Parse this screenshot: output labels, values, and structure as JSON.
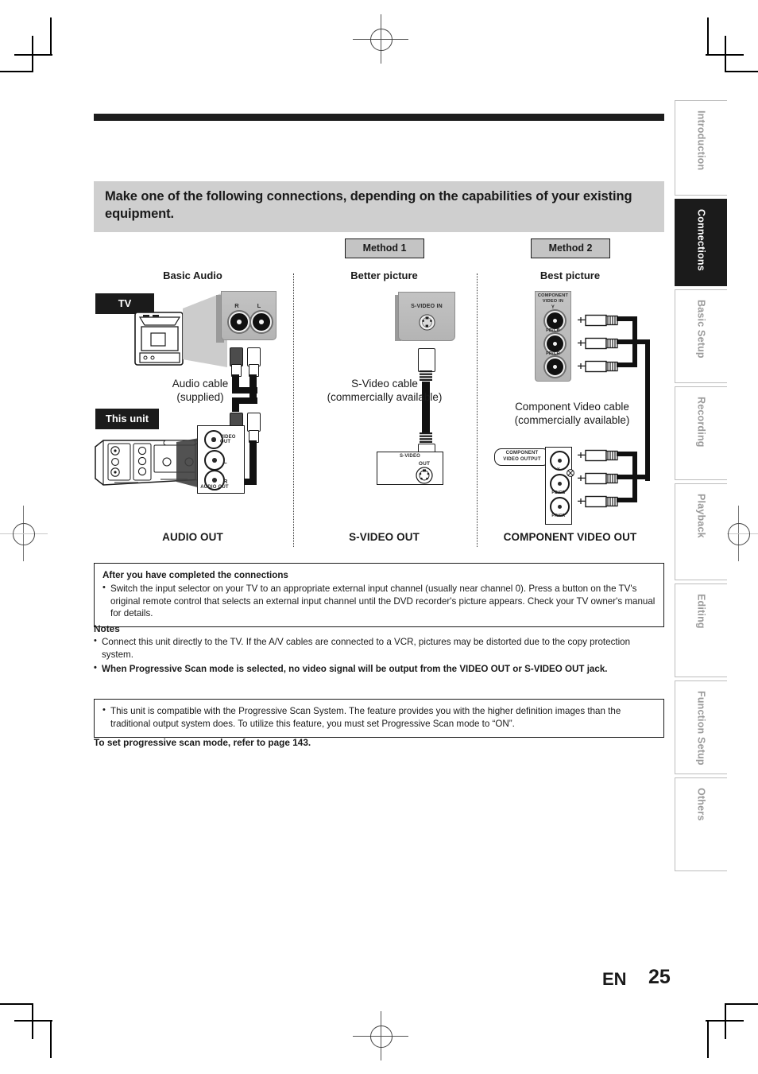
{
  "page": {
    "language_code": "EN",
    "page_number": "25"
  },
  "banner": {
    "heading": "Make one of the following connections, depending on the capabilities of your existing equipment."
  },
  "methods": {
    "method1_label": "Method 1",
    "method2_label": "Method 2"
  },
  "columns": [
    {
      "header": "Basic Audio",
      "footer": "AUDIO OUT",
      "cable_caption": "Audio cable\n(supplied)",
      "cable_caption_line1": "Audio cable",
      "cable_caption_line2": "(supplied)"
    },
    {
      "header": "Better picture",
      "footer": "S-VIDEO OUT",
      "cable_caption_line1": "S-Video cable",
      "cable_caption_line2": "(commercially available)"
    },
    {
      "header": "Best picture",
      "footer": "COMPONENT VIDEO OUT",
      "cable_caption_line1": "Component Video cable",
      "cable_caption_line2": "(commercially available)"
    }
  ],
  "chips": {
    "tv": "TV",
    "this_unit": "This unit"
  },
  "jack_labels": {
    "tv_audio_r": "R",
    "tv_audio_l": "L",
    "tv_svideo_in": "S-VIDEO IN",
    "tv_component_in_line1": "COMPONENT",
    "tv_component_in_line2": "VIDEO IN",
    "component_y": "Y",
    "component_pb": "PB/CB",
    "component_pr": "PR/CR",
    "unit_video_out": "VIDEO OUT",
    "unit_audio_out": "AUDIO OUT",
    "unit_audio_l": "L",
    "unit_audio_r": "R",
    "unit_svideo": "S-VIDEO",
    "unit_svideo_out": "OUT",
    "unit_component_out_line1": "COMPONENT",
    "unit_component_out_line2": "VIDEO OUTPUT"
  },
  "after_box": {
    "title": "After you have completed the connections",
    "bullet": "Switch the input selector on your TV to an appropriate external input channel (usually near channel 0). Press a button on the TV's original remote control that selects an external input channel until the DVD recorder's picture appears. Check your TV owner's manual for details."
  },
  "notes": {
    "label": "Notes",
    "items": [
      {
        "text": "Connect this unit directly to the TV. If the A/V cables are connected to a VCR, pictures may be distorted due to the copy protection system.",
        "bold": false
      },
      {
        "text": "When Progressive Scan mode is selected, no video signal will be output from the VIDEO OUT or S-VIDEO OUT jack.",
        "bold": true
      }
    ]
  },
  "progressive_box": {
    "bullet": "This unit is compatible with the Progressive Scan System. The feature provides you with the higher definition images than the traditional output system does. To utilize this feature, you must set Progressive Scan mode to “ON”."
  },
  "progressive_reference": "To set progressive scan mode, refer to page 143.",
  "sidebar": {
    "tabs": [
      {
        "label": "Introduction",
        "active": false
      },
      {
        "label": "Connections",
        "active": true
      },
      {
        "label": "Basic Setup",
        "active": false
      },
      {
        "label": "Recording",
        "active": false
      },
      {
        "label": "Playback",
        "active": false
      },
      {
        "label": "Editing",
        "active": false
      },
      {
        "label": "Function Setup",
        "active": false
      },
      {
        "label": "Others",
        "active": false
      }
    ]
  },
  "colors": {
    "banner_background": "#cfcfcf",
    "badge_background": "#c4c4c4",
    "chip_background": "#1b1b1b",
    "active_tab_background": "#1b1b1b",
    "inactive_tab_text": "#9a9a9a",
    "rule": "#1d1d1d"
  }
}
